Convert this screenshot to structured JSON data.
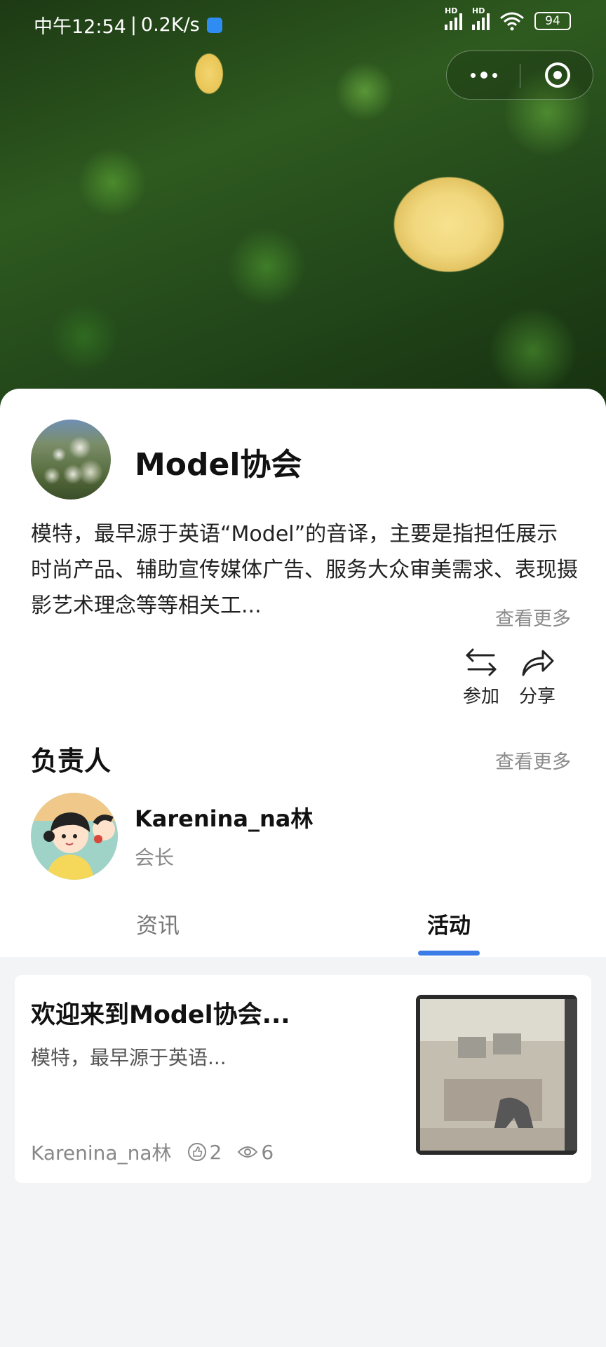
{
  "status_bar": {
    "time": "中午12:54",
    "speed": "0.2K/s",
    "hd1": "HD",
    "hd2": "HD",
    "battery": "94"
  },
  "capsule": {
    "more_icon": "more-dots-icon",
    "close_icon": "target-circle-icon"
  },
  "club": {
    "name": "Model协会",
    "description": "模特，最早源于英语“Model”的音译，主要是指担任展示时尚产品、辅助宣传媒体广告、服务大众审美需求、表现摄影艺术理念等等相关工...",
    "see_more": "查看更多"
  },
  "actions": {
    "join_label": "参加",
    "share_label": "分享"
  },
  "leader_section": {
    "title": "负责人",
    "see_more": "查看更多",
    "name": "Karenina_na林",
    "role": "会长"
  },
  "tabs": [
    {
      "label": "资讯",
      "active": false
    },
    {
      "label": "活动",
      "active": true
    }
  ],
  "feed": [
    {
      "title": "欢迎来到Model协会...",
      "summary": "模特，最早源于英语...",
      "author": "Karenina_na林",
      "likes": "2",
      "views": "6"
    }
  ],
  "colors": {
    "accent": "#3b7ce6",
    "muted_text": "#8a8a8a",
    "page_bg": "#f3f4f6"
  }
}
